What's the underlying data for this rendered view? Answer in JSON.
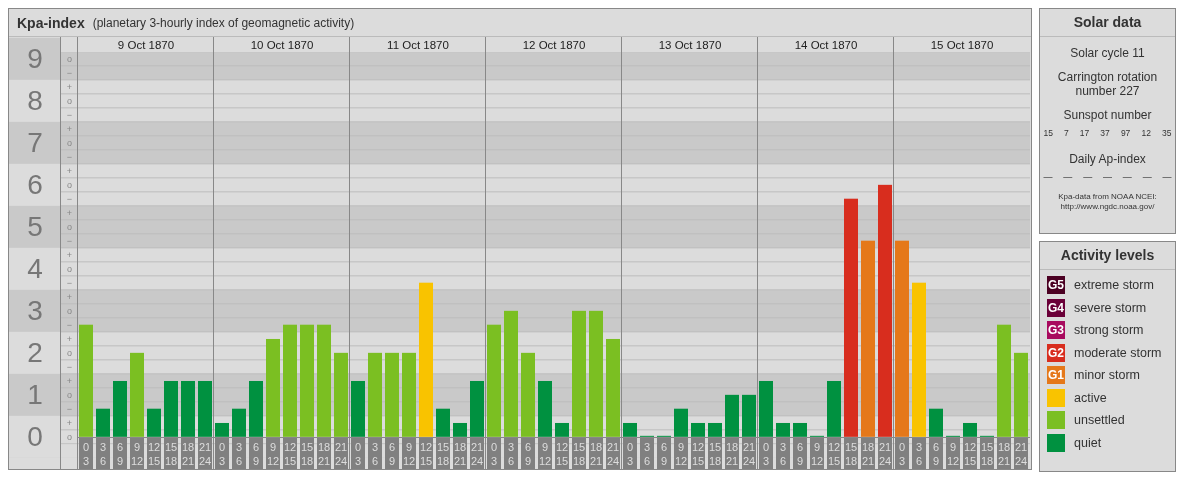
{
  "chart_panel": {
    "title": "Kpa-index",
    "subtitle": "(planetary 3-hourly index of geomagnetic activity)",
    "days": [
      "9 Oct 1870",
      "10 Oct 1870",
      "11 Oct 1870",
      "12 Oct 1870",
      "13 Oct 1870",
      "14 Oct 1870",
      "15 Oct 1870"
    ],
    "minor_tick_labels": [
      "o",
      "−",
      "+",
      "o",
      "−",
      "+",
      "o",
      "−",
      "+",
      "o",
      "−",
      "+",
      "o",
      "−",
      "+",
      "o",
      "−",
      "+",
      "o",
      "−",
      "+",
      "o",
      "−",
      "+",
      "o",
      "−",
      "+",
      "o"
    ],
    "chart_data": {
      "type": "bar",
      "ylim": [
        0,
        9.52
      ],
      "grid": true,
      "yticks": [
        9,
        8,
        7,
        6,
        5,
        4,
        3,
        2,
        1,
        0
      ],
      "categories": [
        "0\n3",
        "3\n6",
        "6\n9",
        "9\n12",
        "12\n15",
        "15\n18",
        "18\n21",
        "21\n24",
        "0\n3",
        "3\n6",
        "6\n9",
        "9\n12",
        "12\n15",
        "15\n18",
        "18\n21",
        "21\n24",
        "0\n3",
        "3\n6",
        "6\n9",
        "9\n12",
        "12\n15",
        "15\n18",
        "18\n21",
        "21\n24",
        "0\n3",
        "3\n6",
        "6\n9",
        "9\n12",
        "12\n15",
        "15\n18",
        "18\n21",
        "21\n24",
        "0\n3",
        "3\n6",
        "6\n9",
        "9\n12",
        "12\n15",
        "15\n18",
        "18\n21",
        "21\n24",
        "0\n3",
        "3\n6",
        "6\n9",
        "9\n12",
        "12\n15",
        "15\n18",
        "18\n21",
        "21\n24",
        "0\n3",
        "3\n6",
        "6\n9",
        "9\n12",
        "12\n15",
        "15\n18",
        "18\n21",
        "21\n24"
      ],
      "series": [
        {
          "color": "#009140",
          "values": [
            null,
            0.67,
            1.33,
            null,
            0.67,
            1.33,
            1.33,
            1.33,
            0.33,
            0.67,
            1.33,
            null,
            null,
            null,
            null,
            null,
            1.33,
            null,
            null,
            null,
            null,
            0.67,
            0.33,
            1.33,
            null,
            null,
            null,
            1.33,
            0.33,
            null,
            null,
            null,
            0.33,
            0,
            0,
            0.67,
            0.33,
            0.33,
            1,
            1,
            1.33,
            0.33,
            0.33,
            0,
            1.33,
            null,
            null,
            null,
            null,
            null,
            0.67,
            0,
            0.33,
            0,
            null,
            null
          ]
        },
        {
          "color": "#7bbf22",
          "values": [
            2.67,
            null,
            null,
            2,
            null,
            null,
            null,
            null,
            null,
            null,
            null,
            2.33,
            2.67,
            2.67,
            2.67,
            2,
            null,
            2,
            2,
            2,
            null,
            null,
            null,
            null,
            2.67,
            3,
            2,
            null,
            null,
            3,
            3,
            2.33,
            null,
            null,
            null,
            null,
            null,
            null,
            null,
            null,
            null,
            null,
            null,
            null,
            null,
            null,
            null,
            null,
            null,
            null,
            null,
            null,
            null,
            null,
            2.67,
            2
          ]
        },
        {
          "color": "#f9c300",
          "values": [
            null,
            null,
            null,
            null,
            null,
            null,
            null,
            null,
            null,
            null,
            null,
            null,
            null,
            null,
            null,
            null,
            null,
            null,
            null,
            null,
            3.67,
            null,
            null,
            null,
            null,
            null,
            null,
            null,
            null,
            null,
            null,
            null,
            null,
            null,
            null,
            null,
            null,
            null,
            null,
            null,
            null,
            null,
            null,
            null,
            null,
            null,
            null,
            null,
            null,
            3.67,
            null,
            null,
            null,
            null,
            null,
            null
          ]
        },
        {
          "color": "#e5781a",
          "values": [
            null,
            null,
            null,
            null,
            null,
            null,
            null,
            null,
            null,
            null,
            null,
            null,
            null,
            null,
            null,
            null,
            null,
            null,
            null,
            null,
            null,
            null,
            null,
            null,
            null,
            null,
            null,
            null,
            null,
            null,
            null,
            null,
            null,
            null,
            null,
            null,
            null,
            null,
            null,
            null,
            null,
            null,
            null,
            null,
            null,
            null,
            4.67,
            null,
            4.67,
            null,
            null,
            null,
            null,
            null,
            null,
            null
          ]
        },
        {
          "color": "#d82d1e",
          "values": [
            null,
            null,
            null,
            null,
            null,
            null,
            null,
            null,
            null,
            null,
            null,
            null,
            null,
            null,
            null,
            null,
            null,
            null,
            null,
            null,
            null,
            null,
            null,
            null,
            null,
            null,
            null,
            null,
            null,
            null,
            null,
            null,
            null,
            null,
            null,
            null,
            null,
            null,
            null,
            null,
            null,
            null,
            null,
            null,
            null,
            5.67,
            null,
            6,
            null,
            null,
            null,
            null,
            null,
            null,
            null,
            null
          ]
        }
      ]
    }
  },
  "solar_data": {
    "title": "Solar data",
    "cycle": "Solar cycle 11",
    "carrington": "Carrington rotation number 227",
    "sunspot_title": "Sunspot number",
    "sunspot_numbers": [
      "15",
      "7",
      "17",
      "37",
      "97",
      "12",
      "35"
    ],
    "ap_title": "Daily Ap-index",
    "ap_values": [
      "—",
      "—",
      "—",
      "—",
      "—",
      "—",
      "—"
    ],
    "source_lines": [
      "Kpa-data from NOAA NCEI:",
      "http://www.ngdc.noaa.gov/"
    ]
  },
  "activity_levels": {
    "title": "Activity levels",
    "items": [
      {
        "badge": "G5",
        "label": "extreme storm",
        "color": "#4b0022"
      },
      {
        "badge": "G4",
        "label": "severe storm",
        "color": "#6a0038"
      },
      {
        "badge": "G3",
        "label": "strong storm",
        "color": "#a80a5e"
      },
      {
        "badge": "G2",
        "label": "moderate storm",
        "color": "#d82d1e"
      },
      {
        "badge": "G1",
        "label": "minor storm",
        "color": "#e5781a"
      },
      {
        "label": "active",
        "color": "#f9c300"
      },
      {
        "label": "unsettled",
        "color": "#7bbf22"
      },
      {
        "label": "quiet",
        "color": "#009140"
      }
    ]
  }
}
